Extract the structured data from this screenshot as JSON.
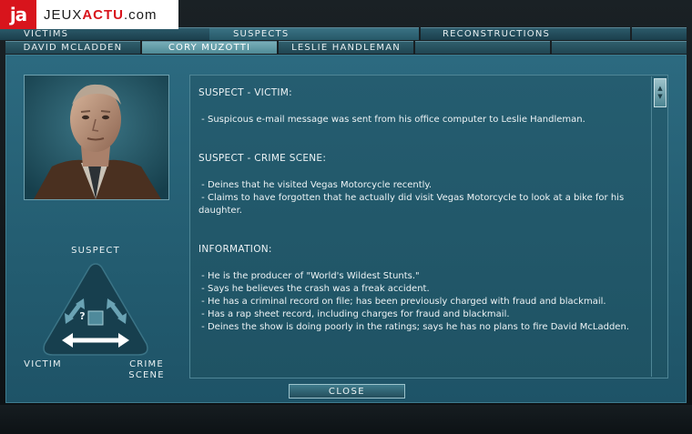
{
  "logo": {
    "mark": "ja",
    "text_prefix": "JEUX",
    "text_accent": "ACTU",
    "text_suffix": ".com"
  },
  "top_tabs": [
    {
      "label": "Victims",
      "active": false
    },
    {
      "label": "Suspects",
      "active": true
    },
    {
      "label": "Reconstructions",
      "active": false
    }
  ],
  "sub_tabs": [
    {
      "label": "David McLadden",
      "active": false
    },
    {
      "label": "Cory Muzotti",
      "active": true
    },
    {
      "label": "Leslie Handleman",
      "active": false
    }
  ],
  "triangle": {
    "top_label": "Suspect",
    "left_label": "Victim",
    "right_label_1": "Crime",
    "right_label_2": "Scene",
    "center_glyph": "?"
  },
  "notes": {
    "sections": [
      {
        "heading": "SUSPECT - VICTIM:",
        "lines": [
          " - Suspicous e-mail message was sent from his office computer to Leslie Handleman."
        ]
      },
      {
        "heading": "SUSPECT - CRIME SCENE:",
        "lines": [
          " - Deines that he visited Vegas Motorcycle recently.",
          " - Claims to have forgotten that he actually did visit Vegas Motorcycle to look at a bike for his",
          "daughter."
        ]
      },
      {
        "heading": "INFORMATION:",
        "lines": [
          " - He is the producer of \"World's Wildest Stunts.\"",
          " - Says he believes the crash was a freak accident.",
          " - He has a criminal record on file; has been previously charged with fraud and blackmail.",
          " - Has a rap sheet record, including charges for fraud and blackmail.",
          " - Deines the show is doing poorly in the ratings; says he has no plans to fire David McLadden."
        ]
      }
    ]
  },
  "close_label": "Close",
  "colors": {
    "panel": "#2c6a80",
    "logo_red": "#d8141c",
    "text": "#edf3f5"
  }
}
